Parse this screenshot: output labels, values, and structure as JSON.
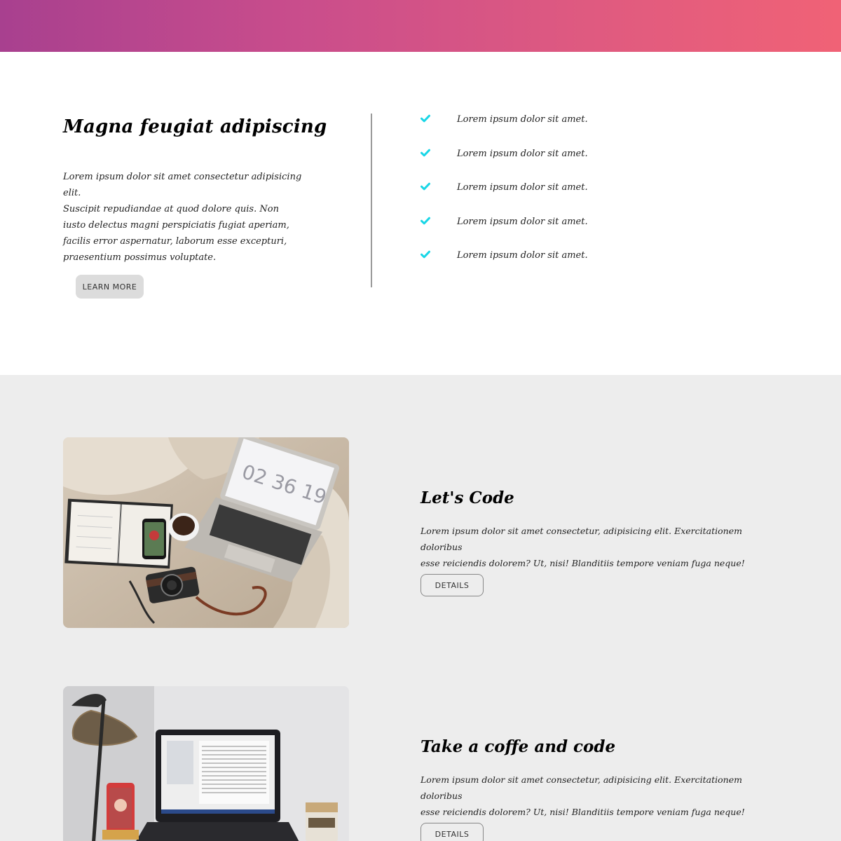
{
  "intro": {
    "title": "Magna feugiat adipiscing",
    "text_lines": [
      "Lorem ipsum dolor sit amet consectetur adipisicing elit.",
      "Suscipit repudiandae at quod dolore quis. Non",
      "iusto delectus magni perspiciatis fugiat aperiam,",
      "facilis error aspernatur, laborum esse excepturi,",
      "praesentium possimus voluptate."
    ],
    "button_label": "LEARN MORE",
    "checklist": [
      "Lorem ipsum dolor sit amet.",
      "Lorem ipsum dolor sit amet.",
      "Lorem ipsum dolor sit amet.",
      "Lorem ipsum dolor sit amet.",
      "Lorem ipsum dolor sit amet."
    ]
  },
  "features": [
    {
      "title": "Let's Code",
      "text_lines": [
        "Lorem ipsum dolor sit amet consectetur, adipisicing elit. Exercitationem doloribus",
        "esse reiciendis dolorem? Ut, nisi! Blanditiis tempore veniam fuga neque!"
      ],
      "button_label": "DETAILS",
      "image": "laptop-on-bed-photo",
      "clock": "02 36 19"
    },
    {
      "title": "Take a coffe and code",
      "text_lines": [
        "Lorem ipsum dolor sit amet consectetur, adipisicing elit. Exercitationem doloribus",
        "esse reiciendis dolorem? Ut, nisi! Blanditiis tempore veniam fuga neque!"
      ],
      "button_label": "DETAILS",
      "image": "desk-laptop-lamp-photo"
    }
  ],
  "colors": {
    "gradient_start": "#a8408f",
    "gradient_end": "#f06276",
    "check": "#19d6e6",
    "section_bg": "#ededed"
  }
}
